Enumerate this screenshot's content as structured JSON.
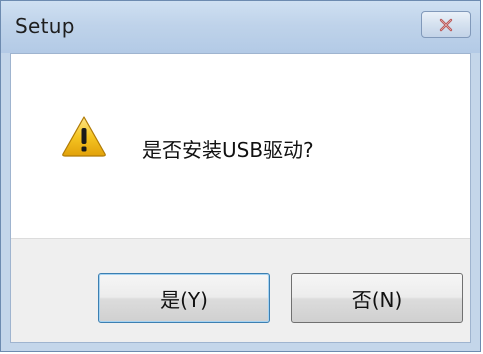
{
  "window": {
    "title": "Setup",
    "close_icon": "close-icon"
  },
  "message": {
    "icon": "warning-icon",
    "text": "是否安装USB驱动?"
  },
  "buttons": {
    "yes_label": "是(Y)",
    "no_label": "否(N)"
  },
  "colors": {
    "titlebar": "#bfd3ea",
    "frame": "#c4d6ea",
    "button_area": "#efefef",
    "warning": "#f0c020",
    "close_x": "#c45a5a"
  }
}
